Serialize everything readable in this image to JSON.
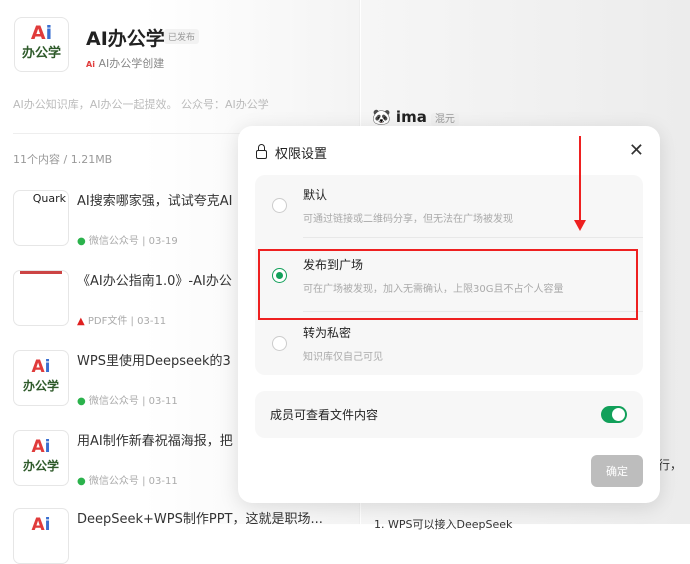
{
  "kb": {
    "title": "AI办公学",
    "badge": "已发布",
    "creator": "AI办公学创建",
    "description": "AI办公知识库，AI办公一起提效。 公众号：AI办公学",
    "count": "11个内容 / 1.21MB",
    "logo_top": "Ai",
    "logo_bottom": "办公学"
  },
  "items": [
    {
      "title": "AI搜索哪家强，试试夸克AI",
      "source": "微信公众号",
      "date": "03-19",
      "thumb": "Quark"
    },
    {
      "title": "《AI办公指南1.0》-AI办公",
      "source": "PDF文件",
      "date": "03-11",
      "thumb": ""
    },
    {
      "title": "WPS里使用Deepseek的3",
      "source": "微信公众号",
      "date": "03-11",
      "thumb": "Ai"
    },
    {
      "title": "用AI制作新春祝福海报，把",
      "source": "微信公众号",
      "date": "03-11",
      "thumb": "Ai"
    },
    {
      "title": "DeepSeek+WPS制作PPT，这就是职场...",
      "source": "",
      "date": "",
      "thumb": "Ai"
    }
  ],
  "right": {
    "name": "ima",
    "tag": "混元",
    "snippet": "行，",
    "bottom": "1. WPS可以接入DeepSeek"
  },
  "modal": {
    "title": "权限设置",
    "options": [
      {
        "label": "默认",
        "desc": "可通过链接或二维码分享，但无法在广场被发现",
        "selected": false
      },
      {
        "label": "发布到广场",
        "desc": "可在广场被发现，加入无需确认，上限30G且不占个人容量",
        "selected": true
      },
      {
        "label": "转为私密",
        "desc": "知识库仅自己可见",
        "selected": false
      }
    ],
    "toggle_label": "成员可查看文件内容",
    "toggle_on": true,
    "confirm": "确定"
  },
  "colors": {
    "accent": "#12a05a",
    "highlight": "#ee2020"
  }
}
